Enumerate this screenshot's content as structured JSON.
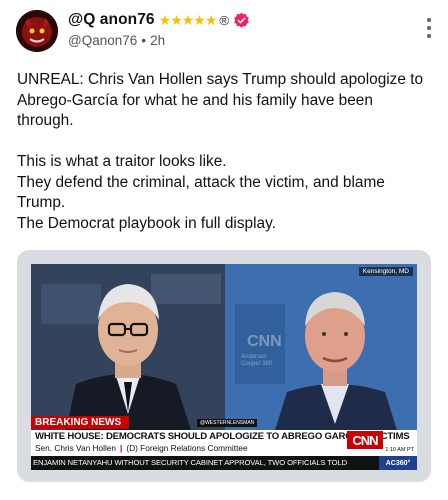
{
  "header": {
    "display_name": "@Q anon76",
    "stars": "★★★★★",
    "reg_mark": "®",
    "handle": "@Qanon76",
    "separator": "•",
    "timestamp": "2h"
  },
  "post": {
    "lines": [
      "UNREAL: Chris Van Hollen says Trump should apologize to Abrego-García for what he and his family have been through.",
      "",
      "This is what a traitor looks like.",
      "They defend the criminal, attack the victim, and blame Trump.",
      "The Democrat playbook in full display."
    ]
  },
  "media": {
    "location": "Kensington, MD",
    "breaking": "BREAKING NEWS",
    "watermark": "@WESTERNLENSMAN",
    "headline": "WHITE HOUSE: DEMOCRATS SHOULD APOLOGIZE TO ABREGO GARCIA'S VICTIMS",
    "subline_name": "Sen. Chris Van Hollen",
    "subline_sep": "|",
    "subline_role": "(D) Foreign Relations Committee",
    "network": "CNN",
    "time": "1:10 AM PT",
    "ticker": "ENJAMIN NETANYAHU WITHOUT SECURITY CABINET APPROVAL, TWO OFFICIALS TOLD",
    "show": "AC360°",
    "background_text_1": "CNN",
    "background_text_2": "Anderson",
    "background_text_3": "Cooper 360"
  },
  "icons": {
    "verified": "verified-badge-icon",
    "more": "more-options-icon"
  },
  "colors": {
    "star": "#f6c000",
    "verified": "#f0245a",
    "breaking": "#cc0000"
  }
}
